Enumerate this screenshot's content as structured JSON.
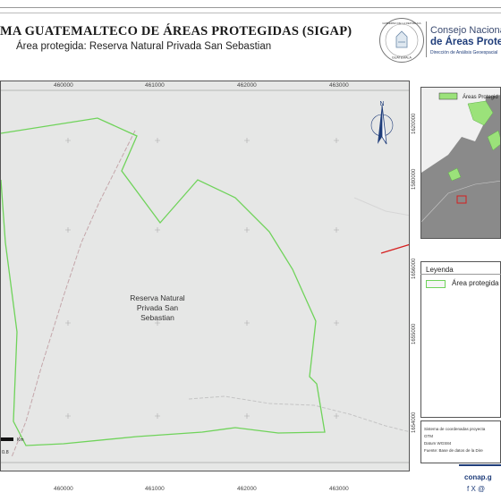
{
  "header": {
    "title": "MA GUATEMALTECO DE ÁREAS PROTEGIDAS  (SIGAP)",
    "subtitle": "Área protegida: Reserva Natural Privada San Sebastian",
    "org_line1": "Consejo Nacional",
    "org_line2": "de Áreas Protegi",
    "org_line3": "Dirección de Análisis Geoespacial",
    "seal_top": "GOBIERNO DE LA REPÚBLICA",
    "seal_bottom": "GUATEMALA"
  },
  "map": {
    "x_coords_top": [
      "460000",
      "461000",
      "462000",
      "463000"
    ],
    "x_coords_bottom": [
      "460000",
      "461000",
      "462000",
      "463000"
    ],
    "area_label_l1": "Reserva Natural",
    "area_label_l2": "Privada San",
    "area_label_l3": "Sebastian",
    "north_label": "N",
    "scale_unit": "Km",
    "scale_value": "0.8",
    "colors": {
      "boundary": "#6fd35a",
      "background": "#e6e7e6",
      "road": "#c8a0a8"
    }
  },
  "inset": {
    "legend_label": "Áreas Protegid",
    "y_coords": [
      "1620000",
      "1580000"
    ]
  },
  "legend": {
    "title": "Leyenda",
    "item": "Área protegida",
    "y_coords": [
      "1656000",
      "1655000",
      "1654000"
    ]
  },
  "info": {
    "line1": "Sistema de coordenadas proyecta",
    "line2": "GTM",
    "line3": "Datum WGS84",
    "line4": "Fuente: Base de datos de la Dire"
  },
  "footer": {
    "website": "conap.g",
    "social": "f  X  @"
  },
  "icons": [
    "north-arrow-icon",
    "facebook-icon",
    "x-icon",
    "instagram-icon"
  ]
}
